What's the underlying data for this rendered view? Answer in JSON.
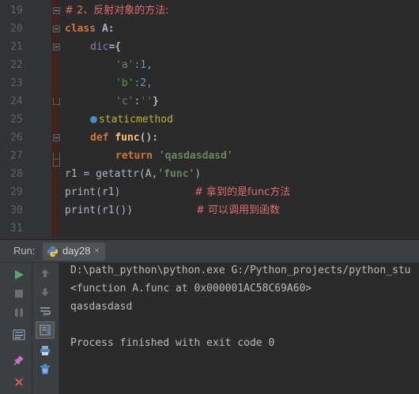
{
  "editor": {
    "line_numbers": [
      "19",
      "20",
      "21",
      "22",
      "23",
      "24",
      "25",
      "26",
      "27",
      "28",
      "29",
      "30",
      "31"
    ],
    "comment_19": "# 2、反射对象的方法:",
    "kw_class": "class",
    "class_name": " A:",
    "dic_name": "dic",
    "eq_brace": "={",
    "key_a": "'a'",
    "val_a": ":1,",
    "key_b": "'b'",
    "val_b": ":2,",
    "key_c": "'c'",
    "val_c_colon": ":",
    "val_c": "''",
    "close_brace": "}",
    "decorator": "staticmethod",
    "kw_def": "def",
    "func_name": "func",
    "func_sig": "():",
    "kw_return": "return",
    "return_value": "'qasdasdasd'",
    "line28_code": "r1 = getattr(A,",
    "line28_str": "'func'",
    "line28_close": ")",
    "line29_code": "print(r1)",
    "line29_comment": "# 拿到的是func方法",
    "line30_code": "print(r1())",
    "line30_comment": "# 可以调用到函数"
  },
  "run_panel": {
    "label": "Run:",
    "tab_label": "day28",
    "tab_close": "×",
    "toolbar_icons": [
      "run-icon",
      "stop-icon",
      "pause-icon",
      "dump-threads-icon",
      "pin-icon",
      "close-icon",
      "up-arrow-icon",
      "down-arrow-icon",
      "soft-wrap-icon",
      "scroll-to-end-icon",
      "print-icon",
      "trash-icon"
    ]
  },
  "console": {
    "line1": "D:\\path_python\\python.exe G:/Python_projects/python_stu",
    "line2": "<function A.func at 0x000001AC58C69A60>",
    "line3": "qasdasdasd",
    "line4": "Process finished with exit code 0"
  },
  "colors": {
    "background": "#2b2b2b",
    "keyword": "#cc7832",
    "string": "#6a8759",
    "number": "#6897bb",
    "comment": "#e06c6c",
    "run_green": "#59a869",
    "close_red": "#e05555"
  }
}
